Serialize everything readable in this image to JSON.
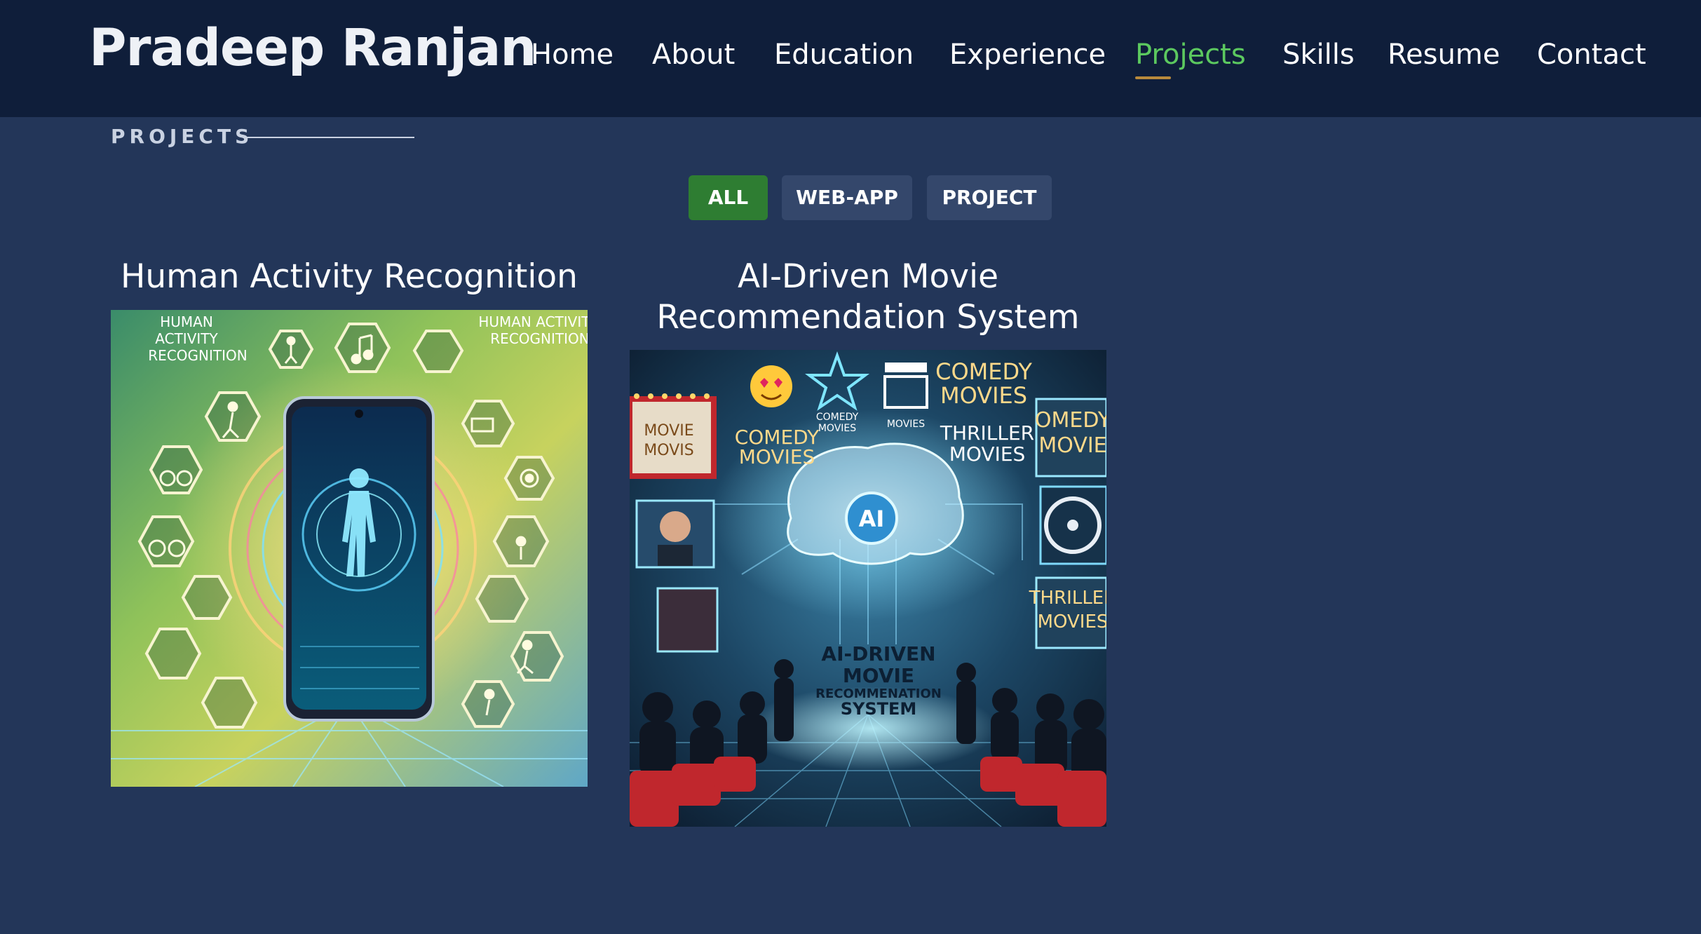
{
  "header": {
    "brand": "Pradeep Ranjan",
    "nav": [
      {
        "label": "Home",
        "active": false
      },
      {
        "label": "About",
        "active": false
      },
      {
        "label": "Education",
        "active": false
      },
      {
        "label": "Experience",
        "active": false
      },
      {
        "label": "Projects",
        "active": true
      },
      {
        "label": "Skills",
        "active": false
      },
      {
        "label": "Resume",
        "active": false
      },
      {
        "label": "Contact",
        "active": false
      }
    ],
    "active_color": "#5cc95f",
    "underline_color": "#b8893c"
  },
  "section": {
    "label": "PROJECTS"
  },
  "filters": [
    {
      "label": "ALL",
      "active": true
    },
    {
      "label": "WEB-APP",
      "active": false
    },
    {
      "label": "PROJECT",
      "active": false
    }
  ],
  "projects": [
    {
      "title": "Human Activity Recognition",
      "image_text": {
        "left": [
          "HUMAN",
          "ACTIVITY",
          "RECOGNITION"
        ],
        "right": [
          "HUMAN ACTIVITY",
          "RECOGNITION"
        ]
      }
    },
    {
      "title_lines": [
        "AI-Driven Movie",
        "Recommendation System"
      ],
      "image_text": {
        "marquee": [
          "MOVIE",
          "MOVIS"
        ],
        "comedy_small": [
          "COMEDY",
          "MOVIES"
        ],
        "comedy_left": [
          "COMEDY",
          "MOVIES"
        ],
        "comedy_top": [
          "COMEDY",
          "MOVIES"
        ],
        "thriller_mid": [
          "THRILLER",
          "MOVIES"
        ],
        "comedy_right": [
          "OMEDY",
          "MOVIE"
        ],
        "thriller_right": [
          "THRILLER",
          "MOVIES"
        ],
        "movies_small": "MOVIES",
        "brain": "AI",
        "system": [
          "AI-DRIVEN",
          "MOVIE",
          "RECOMMENATION",
          "SYSTEM"
        ]
      }
    }
  ],
  "colors": {
    "page_bg": "#233659",
    "header_bg": "#0f1e3a",
    "filter_active": "#2e7d32",
    "filter_inactive": "#34476b"
  }
}
